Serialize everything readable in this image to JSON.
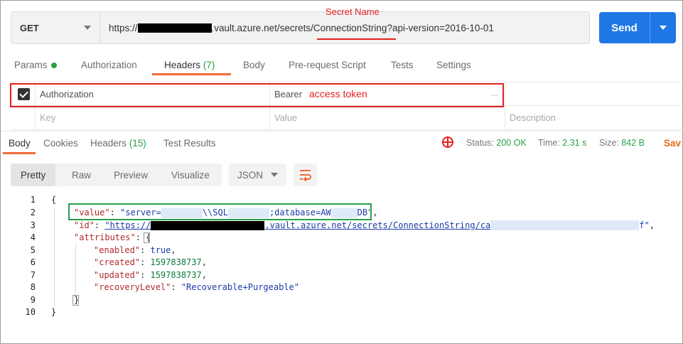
{
  "request": {
    "method": "GET",
    "url_prefix": "https://",
    "url_suffix_1": ".vault.azure.net/secrets/",
    "url_secret": "ConnectionString",
    "url_query": "?api-version=2016-10-01",
    "annotation": "Secret Name",
    "send_label": "Send"
  },
  "request_tabs": {
    "params": "Params",
    "authorization": "Authorization",
    "headers": "Headers",
    "headers_count": "(7)",
    "body": "Body",
    "pre_request": "Pre-request Script",
    "tests": "Tests",
    "settings": "Settings"
  },
  "headers_table": {
    "row1_key": "Authorization",
    "row1_value": "Bearer",
    "row1_annotation": "access token",
    "row1_more": "...",
    "key_placeholder": "Key",
    "value_placeholder": "Value",
    "description_placeholder": "Description"
  },
  "response_tabs": {
    "body": "Body",
    "cookies": "Cookies",
    "headers": "Headers",
    "headers_count": "(15)",
    "test_results": "Test Results"
  },
  "response_status": {
    "status_label": "Status:",
    "status_value": "200 OK",
    "time_label": "Time:",
    "time_value": "2.31 s",
    "size_label": "Size:",
    "size_value": "842 B",
    "save_label": "Sav"
  },
  "view_modes": {
    "pretty": "Pretty",
    "raw": "Raw",
    "preview": "Preview",
    "visualize": "Visualize",
    "format": "JSON"
  },
  "code": {
    "line_numbers": [
      "1",
      "2",
      "3",
      "4",
      "5",
      "6",
      "7",
      "8",
      "9",
      "10"
    ],
    "open_brace": "{",
    "close_brace": "}",
    "value_key": "\"value\"",
    "value_part1": "\"server=",
    "value_part2": "\\\\SQL",
    "value_part3": ";database=AW",
    "value_part4": "DB\"",
    "id_key": "\"id\"",
    "id_prefix": "\"https://",
    "id_mid": ".vault.azure.net/secrets/ConnectionString/ca",
    "id_end": "f\"",
    "attributes_key": "\"attributes\"",
    "enabled_key": "\"enabled\"",
    "enabled_value": "true",
    "created_key": "\"created\"",
    "created_value": "1597838737",
    "updated_key": "\"updated\"",
    "updated_value": "1597838737",
    "recovery_key": "\"recoveryLevel\"",
    "recovery_value": "\"Recoverable+Purgeable\""
  },
  "colors": {
    "send": "#1f77e5",
    "annotation_red": "#e0211e",
    "annotation_green": "#27a147",
    "tab_underline": "#f26b3a"
  }
}
